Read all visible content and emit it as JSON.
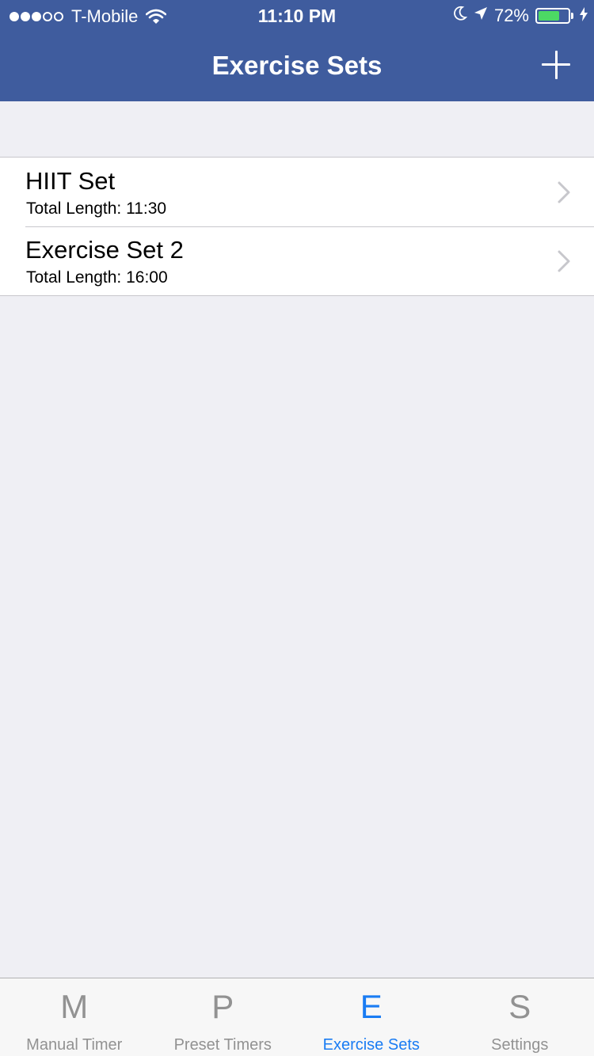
{
  "status_bar": {
    "carrier": "T-Mobile",
    "time": "11:10 PM",
    "battery_percent": "72%",
    "battery_level": 0.72,
    "signal_bars_filled": 3,
    "signal_bars_total": 5
  },
  "nav": {
    "title": "Exercise Sets",
    "add_icon": "plus-icon"
  },
  "exercise_sets": [
    {
      "title": "HIIT Set",
      "subtitle": "Total Length: 11:30"
    },
    {
      "title": "Exercise Set 2",
      "subtitle": "Total Length: 16:00"
    }
  ],
  "tabs": [
    {
      "glyph": "M",
      "label": "Manual Timer",
      "active": false
    },
    {
      "glyph": "P",
      "label": "Preset Timers",
      "active": false
    },
    {
      "glyph": "E",
      "label": "Exercise Sets",
      "active": true
    },
    {
      "glyph": "S",
      "label": "Settings",
      "active": false
    }
  ],
  "colors": {
    "nav_bg": "#3f5c9e",
    "active_tab": "#1a7cf3",
    "inactive_tab": "#929292",
    "battery_fill": "#4cd964",
    "background": "#efeff4"
  }
}
